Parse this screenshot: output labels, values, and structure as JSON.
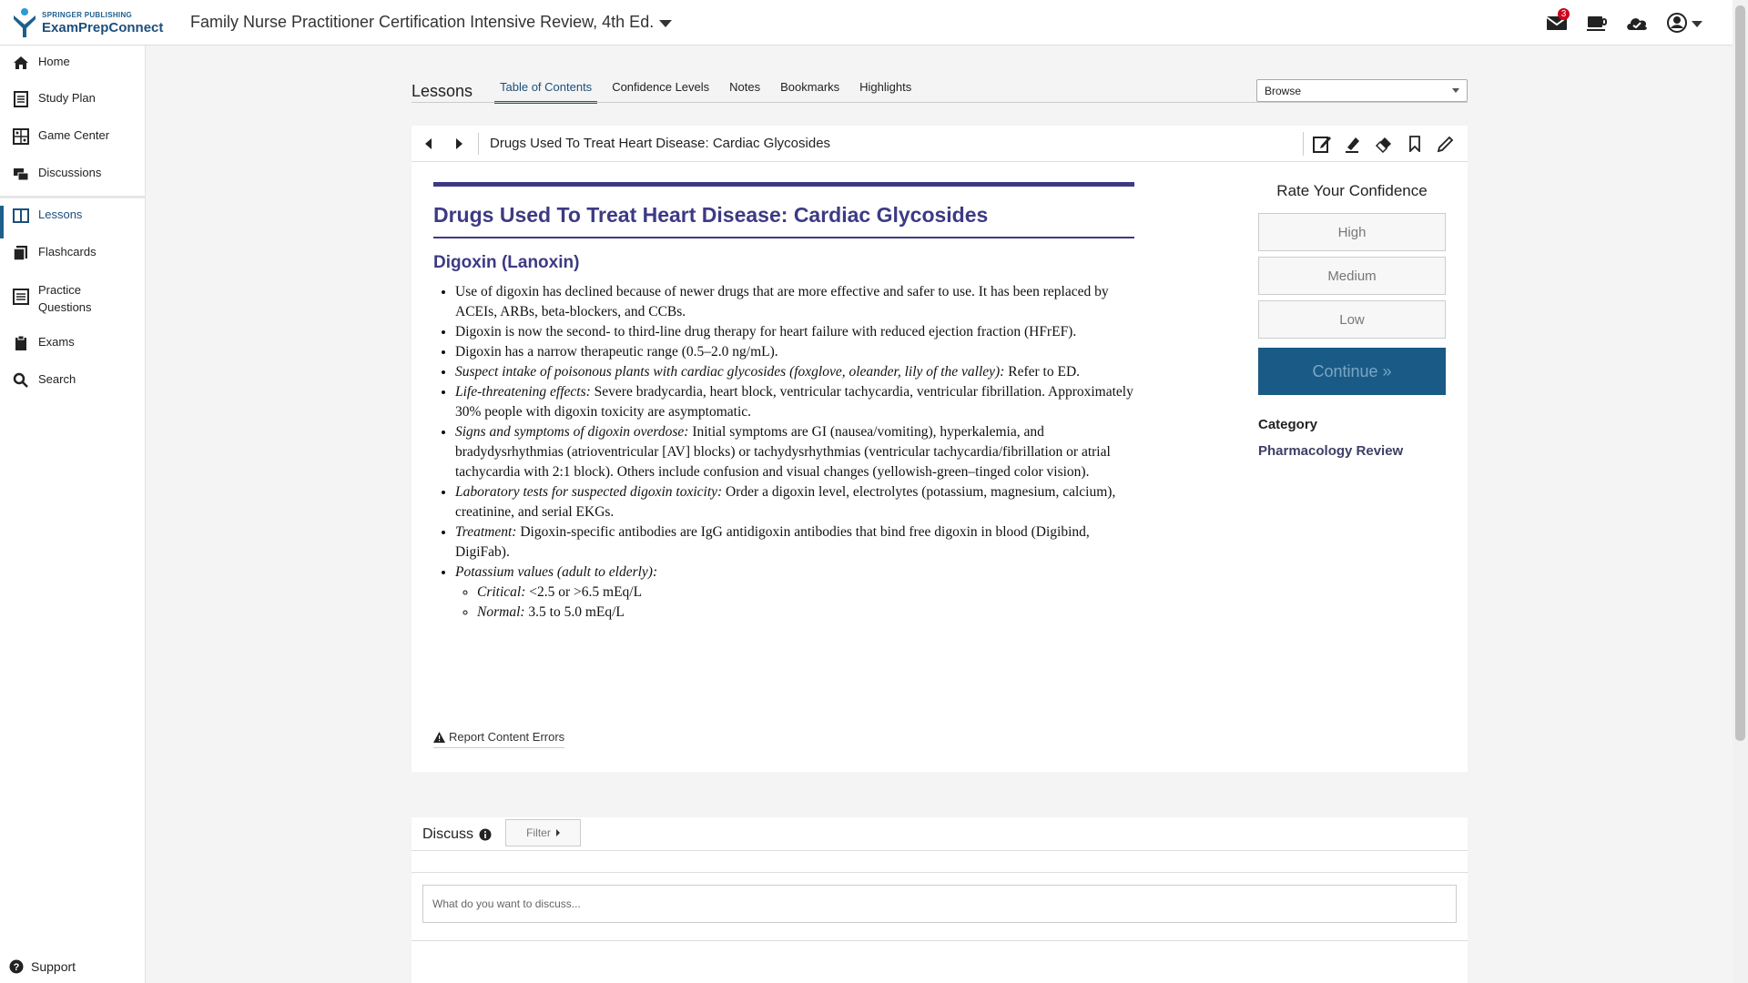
{
  "header": {
    "logo_publisher": "SPRINGER PUBLISHING",
    "logo_name": "ExamPrepConnect",
    "book_title": "Family Nurse Practitioner Certification Intensive Review, 4th Ed.",
    "notification_count": "3",
    "icons": [
      "mail-icon",
      "coffee-cup-icon",
      "cloud-icon",
      "user-account-icon"
    ]
  },
  "sidebar": {
    "items": [
      {
        "label": "Home",
        "icon": "home-icon"
      },
      {
        "label": "Study Plan",
        "icon": "study-plan-icon"
      },
      {
        "label": "Game Center",
        "icon": "game-center-icon"
      },
      {
        "label": "Discussions",
        "icon": "discussions-icon"
      },
      {
        "label": "Lessons",
        "icon": "book-icon",
        "active": true
      },
      {
        "label": "Flashcards",
        "icon": "flashcards-icon"
      },
      {
        "label": "Practice Questions",
        "icon": "practice-questions-icon"
      },
      {
        "label": "Exams",
        "icon": "clipboard-icon"
      },
      {
        "label": "Search",
        "icon": "search-icon"
      }
    ],
    "support_label": "Support"
  },
  "lessons": {
    "title": "Lessons",
    "tabs": [
      "Table of Contents",
      "Confidence Levels",
      "Notes",
      "Bookmarks",
      "Highlights"
    ],
    "active_tab": "Table of Contents",
    "browse_value": "Browse"
  },
  "breadcrumb": {
    "title": "Drugs Used To Treat Heart Disease: Cardiac Glycosides"
  },
  "article": {
    "title": "Drugs Used To Treat Heart Disease: Cardiac Glycosides",
    "subtitle": "Digoxin (Lanoxin)",
    "items": [
      {
        "lead": "",
        "text": "Use of digoxin has declined because of newer drugs that are more effective and safer to use. It has been replaced by ACEIs, ARBs, beta-blockers, and CCBs."
      },
      {
        "lead": "",
        "text": "Digoxin is now the second- to third-line drug therapy for heart failure with reduced ejection fraction (HFrEF)."
      },
      {
        "lead": "",
        "text": "Digoxin has a narrow therapeutic range (0.5–2.0 ng/mL)."
      },
      {
        "lead": "Suspect intake of poisonous plants with cardiac glycosides (foxglove, oleander, lily of the valley):",
        "text": " Refer to ED."
      },
      {
        "lead": "Life-threatening effects:",
        "text": " Severe bradycardia, heart block, ventricular tachycardia, ventricular fibrillation. Approximately 30% people with digoxin toxicity are asymptomatic."
      },
      {
        "lead": "Signs and symptoms of digoxin overdose:",
        "text": " Initial symptoms are GI (nausea/vomiting), hyperkalemia, and bradydysrhythmias (atrioventricular [AV] blocks) or tachydysrhythmias (ventricular tachycardia/fibrillation or atrial tachycardia with 2:1 block). Others include confusion and visual changes (yellowish-green–tinged color vision)."
      },
      {
        "lead": "Laboratory tests for suspected digoxin toxicity:",
        "text": " Order a digoxin level, electrolytes (potassium, magnesium, calcium), creatinine, and serial EKGs."
      },
      {
        "lead": "Treatment:",
        "text": " Digoxin-specific antibodies are IgG antidigoxin antibodies that bind free digoxin in blood (Digibind, DigiFab)."
      },
      {
        "lead": "Potassium values (adult to elderly):",
        "text": ""
      }
    ],
    "subitems": [
      {
        "lead": "Critical:",
        "text": " <2.5 or >6.5 mEq/L"
      },
      {
        "lead": "Normal:",
        "text": " 3.5 to 5.0 mEq/L"
      }
    ],
    "report_label": "Report Content Errors"
  },
  "confidence": {
    "title": "Rate Your Confidence",
    "high": "High",
    "medium": "Medium",
    "low": "Low",
    "continue_label": "Continue »",
    "category_label": "Category",
    "category_value": "Pharmacology Review"
  },
  "discuss": {
    "title": "Discuss",
    "filter_label": "Filter",
    "placeholder": "What do you want to discuss..."
  },
  "colors": {
    "brand": "#1d5f8c",
    "heading": "#3d3a84",
    "continue_bg": "#1a5a86"
  }
}
